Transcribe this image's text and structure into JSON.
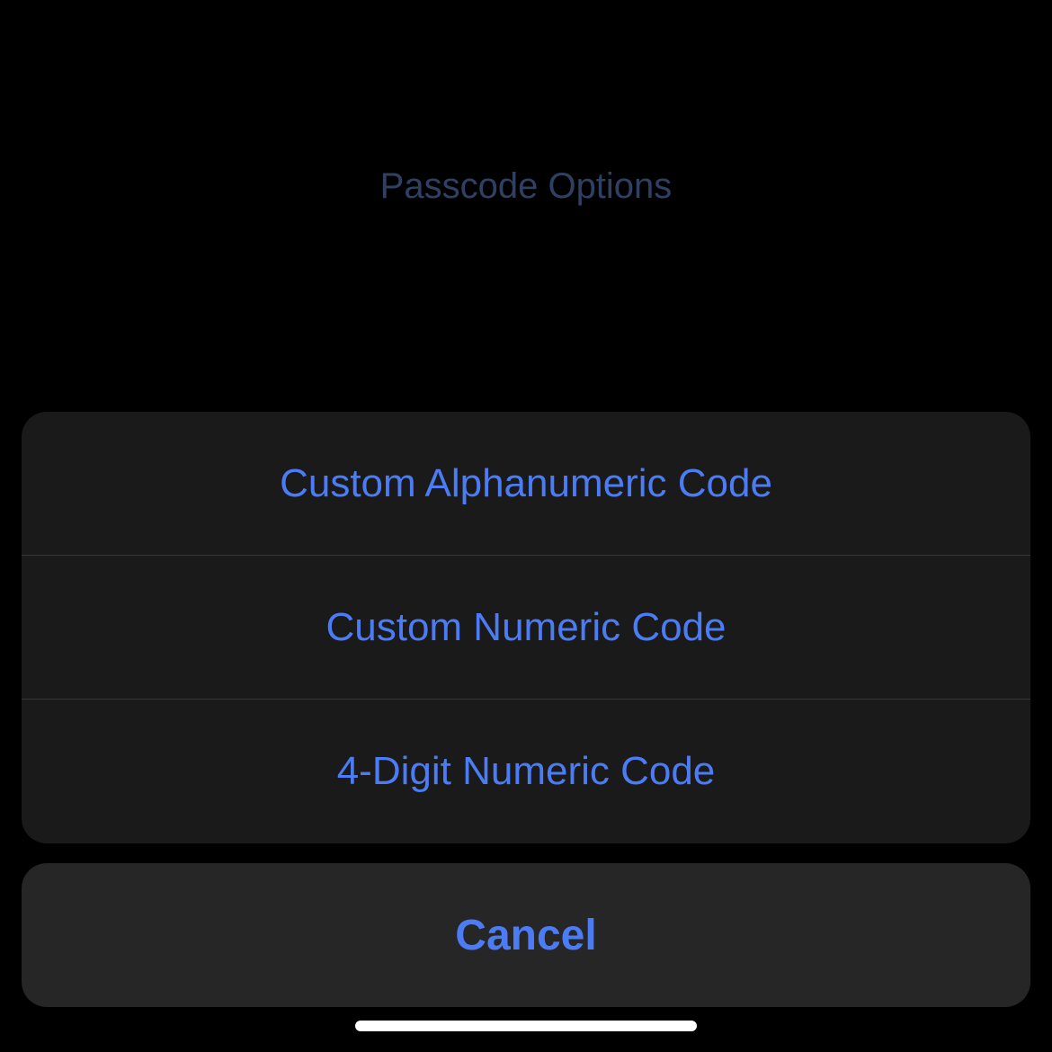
{
  "background": {
    "title": "Passcode Options"
  },
  "actionSheet": {
    "options": [
      {
        "label": "Custom Alphanumeric Code"
      },
      {
        "label": "Custom Numeric Code"
      },
      {
        "label": "4-Digit Numeric Code"
      }
    ],
    "cancel_label": "Cancel"
  }
}
